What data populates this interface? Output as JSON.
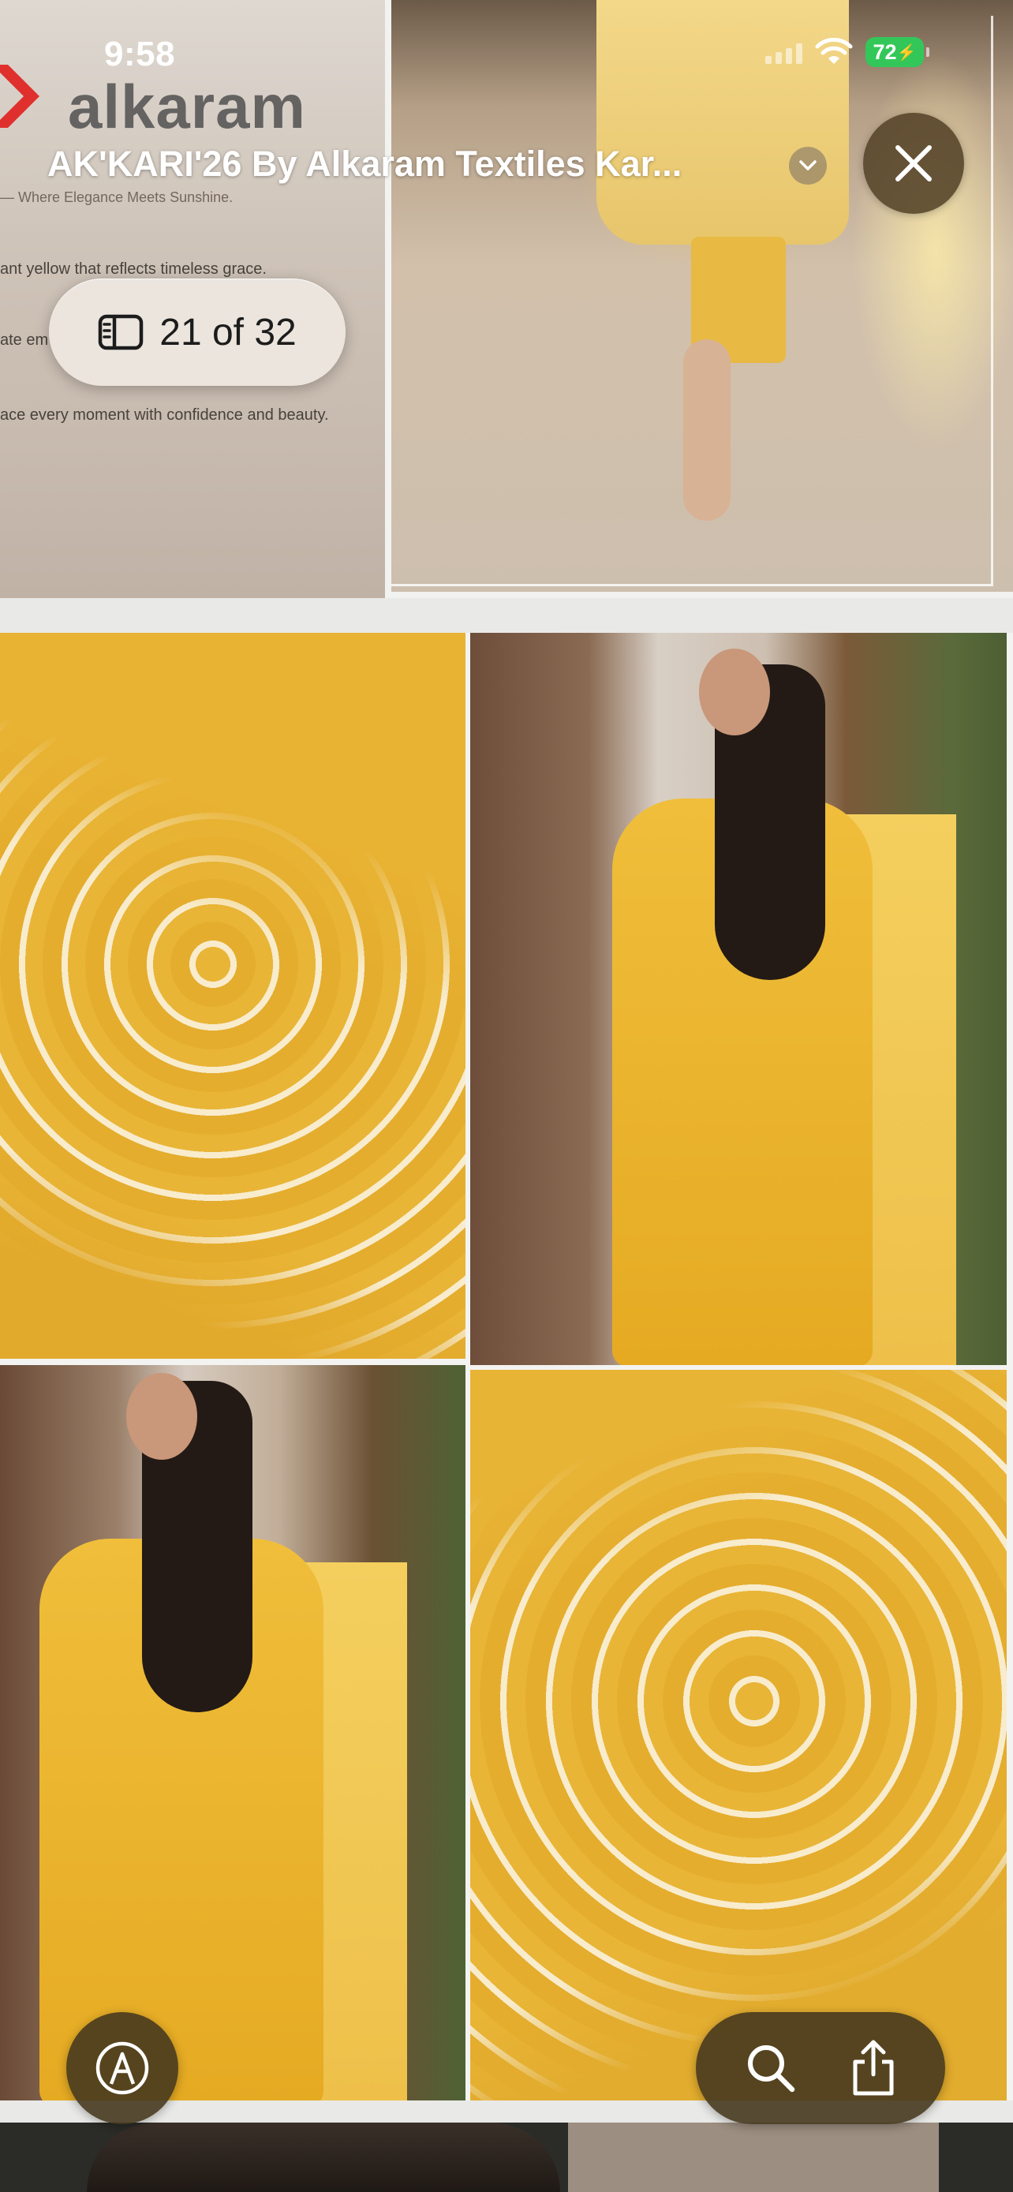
{
  "status_bar": {
    "time": "9:58",
    "battery": "72"
  },
  "viewer": {
    "title": "AK'KARI'26 By Alkaram Textiles Kar...",
    "page_indicator": "21 of 32"
  },
  "flyer": {
    "brand": "alkaram",
    "tagline": "— Where Elegance Meets Sunshine.",
    "line_1": "ant yellow that reflects timeless grace.",
    "line_2": "ate em",
    "line_3": "ace every moment with confidence and beauty."
  },
  "colors": {
    "accent_button": "#4a3a1e",
    "battery_green": "#33c759",
    "fabric_yellow": "#e6b137"
  },
  "icons": [
    "chevron-down-icon",
    "close-icon",
    "sidebar-icon",
    "markup-pen-icon",
    "search-icon",
    "share-icon"
  ]
}
